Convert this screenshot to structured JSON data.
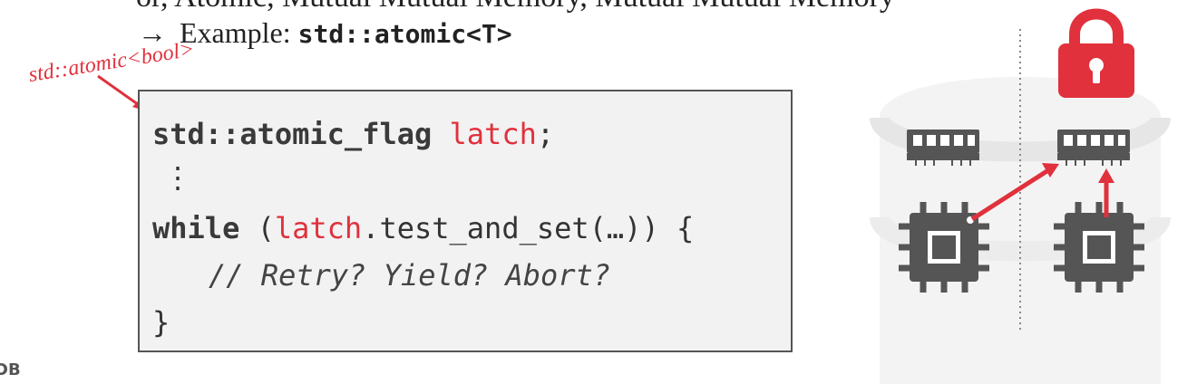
{
  "slide": {
    "top_line": "or, Atomic, Mutual Mutual Memory, Mutual Mutual Memory",
    "bullet_arrow": "→",
    "bullet_prefix": "Example:",
    "bullet_code": "std::atomic<T>",
    "annotation": "std::atomic<bool>",
    "footer_mark": "DB"
  },
  "code": {
    "line1_type": "std::atomic_flag",
    "line1_var": "latch",
    "line1_end": ";",
    "line2": "⋮",
    "line3_kw": "while",
    "line3_open": "(",
    "line3_var": "latch",
    "line3_rest": ".test_and_set(…)) {",
    "line4_comment": "// Retry? Yield? Abort?",
    "line5": "}"
  },
  "colors": {
    "accent": "#e0313c",
    "chip": "#555555",
    "code_bg": "#f2f2f2"
  },
  "icons": [
    "lock-icon",
    "memory-icon",
    "cpu-icon"
  ]
}
